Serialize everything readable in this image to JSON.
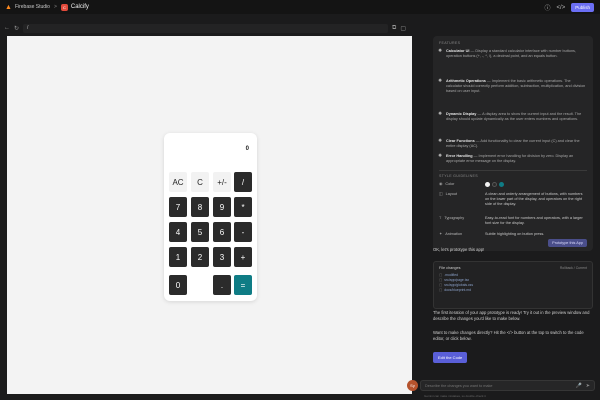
{
  "topbar": {
    "product": "Firebase Studio",
    "separator": ">",
    "app_badge": "C",
    "app_name": "Calcify",
    "icons": [
      "help-icon",
      "code-toggle-icon"
    ],
    "code_icon_label": "</>",
    "publish_label": "Publish"
  },
  "preview": {
    "url": "/",
    "nav_icons": [
      "back-icon",
      "refresh-icon"
    ]
  },
  "calculator": {
    "display": "0",
    "keys": [
      {
        "label": "AC",
        "style": "light"
      },
      {
        "label": "C",
        "style": "light"
      },
      {
        "label": "+/-",
        "style": "light"
      },
      {
        "label": "/",
        "style": "dark"
      },
      {
        "label": "7",
        "style": "dark"
      },
      {
        "label": "8",
        "style": "dark"
      },
      {
        "label": "9",
        "style": "dark"
      },
      {
        "label": "*",
        "style": "dark"
      },
      {
        "label": "4",
        "style": "dark"
      },
      {
        "label": "5",
        "style": "dark"
      },
      {
        "label": "6",
        "style": "dark"
      },
      {
        "label": "-",
        "style": "dark"
      },
      {
        "label": "1",
        "style": "dark"
      },
      {
        "label": "2",
        "style": "dark"
      },
      {
        "label": "3",
        "style": "dark"
      },
      {
        "label": "+",
        "style": "dark"
      },
      {
        "label": "0",
        "style": "dark"
      },
      {
        "label": ".",
        "style": "dark"
      },
      {
        "label": "=",
        "style": "teal"
      }
    ]
  },
  "blueprint": {
    "features_title": "FEATURES",
    "features": [
      {
        "name": "Calculator UI",
        "desc": "Display a standard calculator interface with number buttons, operation buttons (+, -, *, /), a decimal point, and an equals button."
      },
      {
        "name": "Arithmetic Operations",
        "desc": "Implement the basic arithmetic operations. The calculator should correctly perform addition, subtraction, multiplication, and division based on user input."
      },
      {
        "name": "Dynamic Display",
        "desc": "A display area to show the current input and the result. The display should update dynamically as the user enters numbers and operations."
      },
      {
        "name": "Clear Functions",
        "desc": "Add functionality to clear the current input (C) and clear the entire display (AC)."
      },
      {
        "name": "Error Handling",
        "desc": "Implement error handling for division by zero. Display an appropriate error message on the display."
      }
    ],
    "style_title": "STYLE GUIDELINES",
    "style": {
      "color_label": "Color",
      "colors": [
        "#f2f2f2",
        "#2b2b2b",
        "#0f7c85"
      ],
      "layout_label": "Layout",
      "layout_value": "A clean and orderly arrangement of buttons, with numbers on the lower part of the display, and operators on the right side of the display.",
      "typography_label": "Typography",
      "typography_value": "Easy-to-read font for numbers and operators, with a larger font size for the display.",
      "animation_label": "Animation",
      "animation_value": "Subtle highlighting on button press."
    },
    "prototype_button": "Prototype this App"
  },
  "chat": {
    "ack": "OK, let's prototype this app!",
    "file_changes_title": "File changes",
    "file_actions": "Rollback / Current",
    "files": [
      {
        "name": ".modified",
        "icon": "file-icon"
      },
      {
        "name": "src/app/page.tsx",
        "icon": "file-icon"
      },
      {
        "name": "src/app/globals.css",
        "icon": "file-icon"
      },
      {
        "name": "docs/blueprint.md",
        "icon": "file-icon"
      }
    ],
    "message1": "The first iteration of your app prototype is ready! Try it out in the preview window and describe the changes you'd like to make below.",
    "message2": "Want to make changes directly? Hit the </> button at the top to switch to the code editor, or click below.",
    "edit_button": "Edit the Code",
    "avatar_initials": "Sy",
    "input_placeholder": "Describe the changes you want to make",
    "footer_note": "Gemini can make mistakes, so double-check it"
  }
}
